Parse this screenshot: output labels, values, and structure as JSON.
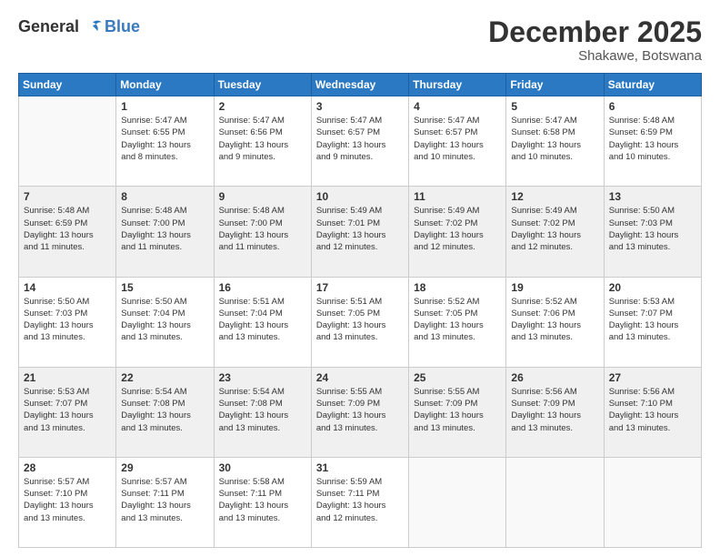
{
  "logo": {
    "general": "General",
    "blue": "Blue"
  },
  "title": "December 2025",
  "location": "Shakawe, Botswana",
  "days_header": [
    "Sunday",
    "Monday",
    "Tuesday",
    "Wednesday",
    "Thursday",
    "Friday",
    "Saturday"
  ],
  "weeks": [
    {
      "shaded": false,
      "days": [
        {
          "num": "",
          "info": ""
        },
        {
          "num": "1",
          "info": "Sunrise: 5:47 AM\nSunset: 6:55 PM\nDaylight: 13 hours\nand 8 minutes."
        },
        {
          "num": "2",
          "info": "Sunrise: 5:47 AM\nSunset: 6:56 PM\nDaylight: 13 hours\nand 9 minutes."
        },
        {
          "num": "3",
          "info": "Sunrise: 5:47 AM\nSunset: 6:57 PM\nDaylight: 13 hours\nand 9 minutes."
        },
        {
          "num": "4",
          "info": "Sunrise: 5:47 AM\nSunset: 6:57 PM\nDaylight: 13 hours\nand 10 minutes."
        },
        {
          "num": "5",
          "info": "Sunrise: 5:47 AM\nSunset: 6:58 PM\nDaylight: 13 hours\nand 10 minutes."
        },
        {
          "num": "6",
          "info": "Sunrise: 5:48 AM\nSunset: 6:59 PM\nDaylight: 13 hours\nand 10 minutes."
        }
      ]
    },
    {
      "shaded": true,
      "days": [
        {
          "num": "7",
          "info": "Sunrise: 5:48 AM\nSunset: 6:59 PM\nDaylight: 13 hours\nand 11 minutes."
        },
        {
          "num": "8",
          "info": "Sunrise: 5:48 AM\nSunset: 7:00 PM\nDaylight: 13 hours\nand 11 minutes."
        },
        {
          "num": "9",
          "info": "Sunrise: 5:48 AM\nSunset: 7:00 PM\nDaylight: 13 hours\nand 11 minutes."
        },
        {
          "num": "10",
          "info": "Sunrise: 5:49 AM\nSunset: 7:01 PM\nDaylight: 13 hours\nand 12 minutes."
        },
        {
          "num": "11",
          "info": "Sunrise: 5:49 AM\nSunset: 7:02 PM\nDaylight: 13 hours\nand 12 minutes."
        },
        {
          "num": "12",
          "info": "Sunrise: 5:49 AM\nSunset: 7:02 PM\nDaylight: 13 hours\nand 12 minutes."
        },
        {
          "num": "13",
          "info": "Sunrise: 5:50 AM\nSunset: 7:03 PM\nDaylight: 13 hours\nand 13 minutes."
        }
      ]
    },
    {
      "shaded": false,
      "days": [
        {
          "num": "14",
          "info": "Sunrise: 5:50 AM\nSunset: 7:03 PM\nDaylight: 13 hours\nand 13 minutes."
        },
        {
          "num": "15",
          "info": "Sunrise: 5:50 AM\nSunset: 7:04 PM\nDaylight: 13 hours\nand 13 minutes."
        },
        {
          "num": "16",
          "info": "Sunrise: 5:51 AM\nSunset: 7:04 PM\nDaylight: 13 hours\nand 13 minutes."
        },
        {
          "num": "17",
          "info": "Sunrise: 5:51 AM\nSunset: 7:05 PM\nDaylight: 13 hours\nand 13 minutes."
        },
        {
          "num": "18",
          "info": "Sunrise: 5:52 AM\nSunset: 7:05 PM\nDaylight: 13 hours\nand 13 minutes."
        },
        {
          "num": "19",
          "info": "Sunrise: 5:52 AM\nSunset: 7:06 PM\nDaylight: 13 hours\nand 13 minutes."
        },
        {
          "num": "20",
          "info": "Sunrise: 5:53 AM\nSunset: 7:07 PM\nDaylight: 13 hours\nand 13 minutes."
        }
      ]
    },
    {
      "shaded": true,
      "days": [
        {
          "num": "21",
          "info": "Sunrise: 5:53 AM\nSunset: 7:07 PM\nDaylight: 13 hours\nand 13 minutes."
        },
        {
          "num": "22",
          "info": "Sunrise: 5:54 AM\nSunset: 7:08 PM\nDaylight: 13 hours\nand 13 minutes."
        },
        {
          "num": "23",
          "info": "Sunrise: 5:54 AM\nSunset: 7:08 PM\nDaylight: 13 hours\nand 13 minutes."
        },
        {
          "num": "24",
          "info": "Sunrise: 5:55 AM\nSunset: 7:09 PM\nDaylight: 13 hours\nand 13 minutes."
        },
        {
          "num": "25",
          "info": "Sunrise: 5:55 AM\nSunset: 7:09 PM\nDaylight: 13 hours\nand 13 minutes."
        },
        {
          "num": "26",
          "info": "Sunrise: 5:56 AM\nSunset: 7:09 PM\nDaylight: 13 hours\nand 13 minutes."
        },
        {
          "num": "27",
          "info": "Sunrise: 5:56 AM\nSunset: 7:10 PM\nDaylight: 13 hours\nand 13 minutes."
        }
      ]
    },
    {
      "shaded": false,
      "days": [
        {
          "num": "28",
          "info": "Sunrise: 5:57 AM\nSunset: 7:10 PM\nDaylight: 13 hours\nand 13 minutes."
        },
        {
          "num": "29",
          "info": "Sunrise: 5:57 AM\nSunset: 7:11 PM\nDaylight: 13 hours\nand 13 minutes."
        },
        {
          "num": "30",
          "info": "Sunrise: 5:58 AM\nSunset: 7:11 PM\nDaylight: 13 hours\nand 13 minutes."
        },
        {
          "num": "31",
          "info": "Sunrise: 5:59 AM\nSunset: 7:11 PM\nDaylight: 13 hours\nand 12 minutes."
        },
        {
          "num": "",
          "info": ""
        },
        {
          "num": "",
          "info": ""
        },
        {
          "num": "",
          "info": ""
        }
      ]
    }
  ]
}
